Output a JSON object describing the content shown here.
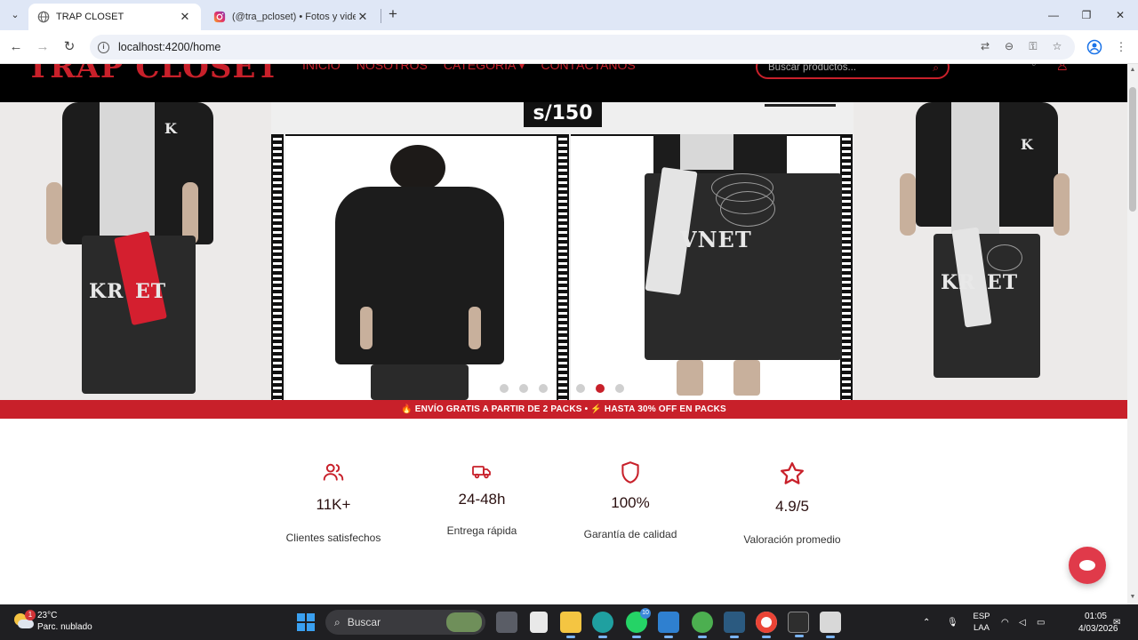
{
  "browser": {
    "tabs": [
      {
        "title": "TRAP CLOSET",
        "active": true,
        "icon": "globe-icon"
      },
      {
        "title": "(@tra_pcloset) • Fotos y videos",
        "active": false,
        "icon": "instagram-icon"
      }
    ],
    "new_tab_icon": "plus-icon",
    "url": "localhost:4200/home",
    "window_controls": [
      "minimize-icon",
      "restore-icon",
      "close-icon"
    ],
    "toolbar_icons": [
      "translate-icon",
      "zoom-icon",
      "key-icon",
      "star-icon",
      "profile-icon",
      "kebab-menu-icon"
    ]
  },
  "site": {
    "logo": "TRAP CLOSET",
    "nav": [
      "INICIO",
      "NOSOTROS",
      "CATEGORÍA ▾",
      "CONTÁCTANOS"
    ],
    "search_placeholder": "Buscar productos...",
    "accent_color": "#c8202a",
    "hero": {
      "price_tag": "s/150",
      "slides_total": 6,
      "active_slide": 5
    },
    "promo": "🔥 ENVÍO GRATIS A PARTIR DE 2 PACKS  • ⚡ HASTA 30% OFF EN PACKS",
    "stats": [
      {
        "icon": "users-icon",
        "value": "11K+",
        "label": "Clientes satisfechos"
      },
      {
        "icon": "truck-icon",
        "value": "24-48h",
        "label": "Entrega rápida"
      },
      {
        "icon": "shield-icon",
        "value": "100%",
        "label": "Garantía de calidad"
      },
      {
        "icon": "star-icon",
        "value": "4.9/5",
        "label": "Valoración promedio"
      }
    ],
    "chat_icon": "chat-bubble-icon"
  },
  "taskbar": {
    "weather": {
      "temp": "23°C",
      "desc": "Parc. nublado",
      "badge": "1"
    },
    "search_label": "Buscar",
    "whatsapp_badge": "10",
    "lang_line1": "ESP",
    "lang_line2": "LAA",
    "time": "01:05",
    "date": "4/03/2026"
  }
}
